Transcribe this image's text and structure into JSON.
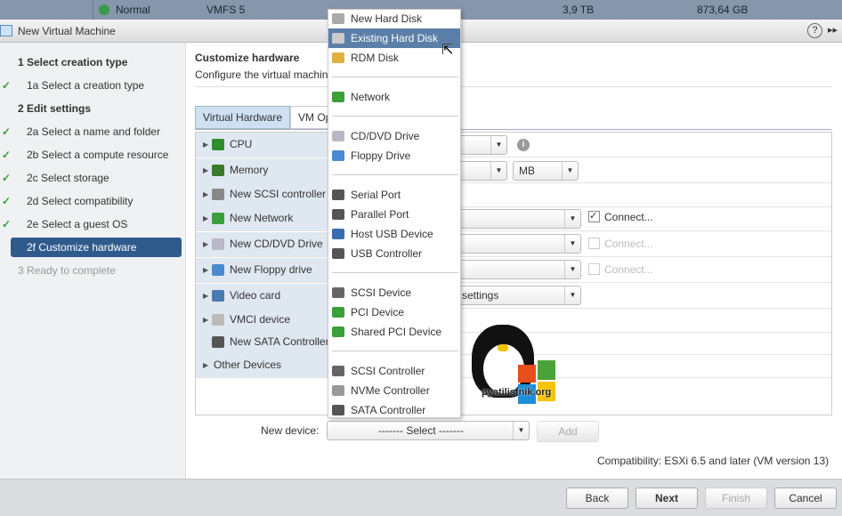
{
  "background_row": {
    "status": "Normal",
    "type": "VMFS 5",
    "capacity": "3,9  TB",
    "free": "873,64  GB"
  },
  "window": {
    "title": "New Virtual Machine",
    "help": "?",
    "expand": "▸▸"
  },
  "steps": [
    {
      "label": "1  Select creation type",
      "done": false,
      "level": 0
    },
    {
      "label": "1a  Select a creation type",
      "done": true,
      "level": 1
    },
    {
      "label": "2  Edit settings",
      "done": false,
      "level": 0
    },
    {
      "label": "2a  Select a name and folder",
      "done": true,
      "level": 1
    },
    {
      "label": "2b  Select a compute resource",
      "done": true,
      "level": 1
    },
    {
      "label": "2c  Select storage",
      "done": true,
      "level": 1
    },
    {
      "label": "2d  Select compatibility",
      "done": true,
      "level": 1
    },
    {
      "label": "2e  Select a guest OS",
      "done": true,
      "level": 1
    },
    {
      "label": "2f  Customize hardware",
      "done": false,
      "level": 1,
      "selected": true
    },
    {
      "label": "3  Ready to complete",
      "done": false,
      "level": 0
    }
  ],
  "main": {
    "title": "Customize hardware",
    "subtitle": "Configure the virtual machin",
    "tabs": [
      "Virtual Hardware",
      "VM Op"
    ],
    "rows": [
      "CPU",
      "Memory",
      "New SCSI controller",
      "New Network",
      "New CD/DVD Drive",
      "New Floppy drive",
      "Video card",
      "VMCI device",
      "New SATA Controller",
      "Other Devices"
    ],
    "memory_unit": "MB",
    "video_value": "settings",
    "connect": "Connect...",
    "new_device_label": "New device:",
    "select_placeholder": "------- Select -------",
    "add": "Add",
    "compatibility": "Compatibility: ESXi 6.5 and later (VM version 13)"
  },
  "menu": {
    "groups": [
      [
        "New Hard Disk",
        "Existing Hard Disk",
        "RDM Disk"
      ],
      [
        "Network"
      ],
      [
        "CD/DVD Drive",
        "Floppy Drive"
      ],
      [
        "Serial Port",
        "Parallel Port",
        "Host USB Device",
        "USB Controller"
      ],
      [
        "SCSI Device",
        "PCI Device",
        "Shared PCI Device"
      ],
      [
        "SCSI Controller",
        "NVMe Controller",
        "SATA Controller"
      ]
    ],
    "highlighted": "Existing Hard Disk"
  },
  "watermark": "pyatilistnik.org",
  "footer": {
    "back": "Back",
    "next": "Next",
    "finish": "Finish",
    "cancel": "Cancel"
  }
}
